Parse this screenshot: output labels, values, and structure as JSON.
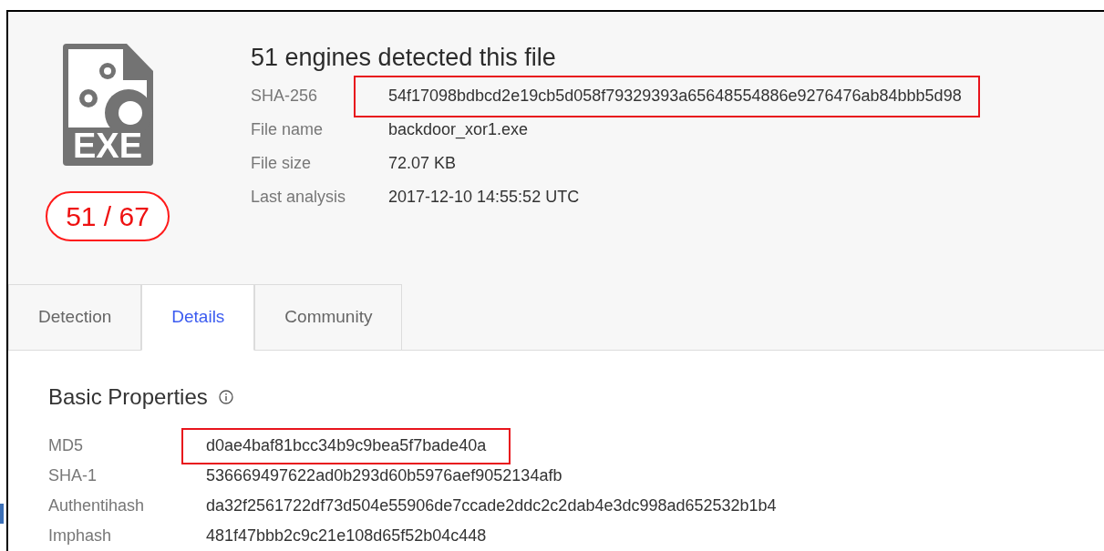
{
  "summary": {
    "title": "51 engines detected this file",
    "detection_ratio": "51 / 67",
    "fields": [
      {
        "label": "SHA-256",
        "value": "54f17098bdbcd2e19cb5d058f79329393a65648554886e9276476ab84bbb5d98",
        "highlighted": true
      },
      {
        "label": "File name",
        "value": "backdoor_xor1.exe",
        "highlighted": false
      },
      {
        "label": "File size",
        "value": "72.07 KB",
        "highlighted": false
      },
      {
        "label": "Last analysis",
        "value": "2017-12-10 14:55:52 UTC",
        "highlighted": false
      }
    ]
  },
  "file_icon": {
    "label": "EXE"
  },
  "tabs": [
    {
      "label": "Detection",
      "selected": false
    },
    {
      "label": "Details",
      "selected": true
    },
    {
      "label": "Community",
      "selected": false
    }
  ],
  "basic_properties": {
    "title": "Basic Properties",
    "rows": [
      {
        "label": "MD5",
        "value": "d0ae4baf81bcc34b9c9bea5f7bade40a",
        "highlighted": true
      },
      {
        "label": "SHA-1",
        "value": "536669497622ad0b293d60b5976aef9052134afb",
        "highlighted": false
      },
      {
        "label": "Authentihash",
        "value": "da32f2561722df73d504e55906de7ccade2ddc2c2dab4e3dc998ad652532b1b4",
        "highlighted": false
      },
      {
        "label": "Imphash",
        "value": "481f47bbb2c9c21e108d65f52b04c448",
        "highlighted": false
      }
    ]
  }
}
